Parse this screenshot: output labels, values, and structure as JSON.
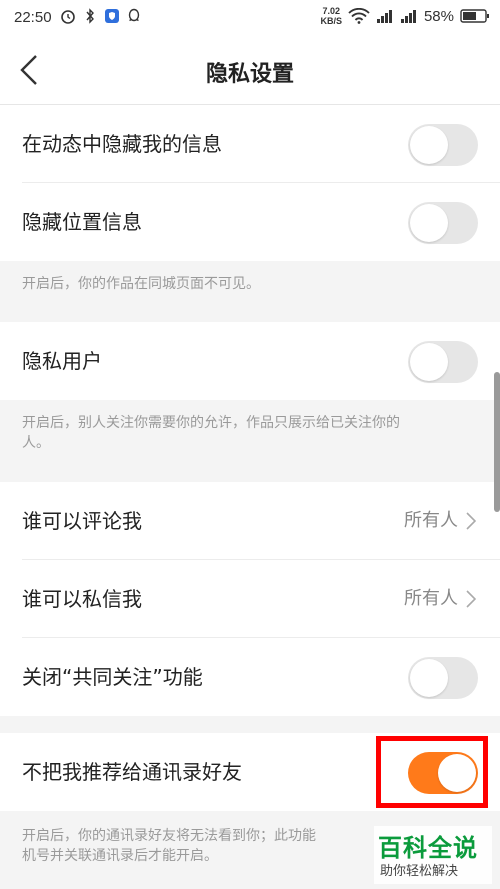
{
  "status_bar": {
    "time": "22:50",
    "net_speed_top": "7.02",
    "net_speed_bottom": "KB/S",
    "battery": "58%"
  },
  "header": {
    "title": "隐私设置",
    "back_icon": "back-arrow-icon"
  },
  "settings": {
    "hide_in_feed": {
      "label": "在动态中隐藏我的信息",
      "enabled": false
    },
    "hide_location": {
      "label": "隐藏位置信息",
      "enabled": false,
      "note": "开启后，你的作品在同城页面不可见。"
    },
    "private_user": {
      "label": "隐私用户",
      "enabled": false,
      "note_line1": "开启后，别人关注你需要你的允许，作品只展示给已关注你的",
      "note_line2": "人。"
    },
    "who_comment": {
      "label": "谁可以评论我",
      "value": "所有人"
    },
    "who_message": {
      "label": "谁可以私信我",
      "value": "所有人"
    },
    "mutual_follow": {
      "label": "关闭“共同关注”功能",
      "enabled": false
    },
    "recommend_contacts": {
      "label": "不把我推荐给通讯录好友",
      "enabled": true,
      "note_line1": "开启后，你的通讯录好友将无法看到你；此功能",
      "note_line2": "机号并关联通讯录后才能开启。"
    }
  },
  "colors": {
    "toggle_on": "#ff7a1a",
    "toggle_off": "#e6e6e6",
    "highlight": "#ff0000"
  },
  "watermark": {
    "title": "百科全说",
    "subtitle": "助你轻松解决"
  }
}
